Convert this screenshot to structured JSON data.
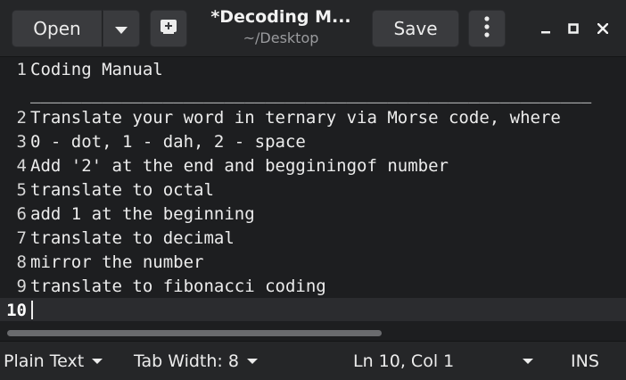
{
  "header": {
    "open_label": "Open",
    "save_label": "Save",
    "title": "*Decoding M...",
    "subtitle": "~/Desktop",
    "icons": {
      "open_menu": "chevron-down-icon",
      "new_tab": "new-tab-icon",
      "more": "more-vertical-icon",
      "minimize": "minimize-icon",
      "maximize": "maximize-icon",
      "close": "close-icon"
    }
  },
  "editor": {
    "lines": [
      {
        "num": "1",
        "text": "Coding Manual"
      },
      {
        "num": "",
        "text": "_______________________________________________________"
      },
      {
        "num": "2",
        "text": "Translate your word in ternary via Morse code, where"
      },
      {
        "num": "3",
        "text": "0 - dot, 1 - dah, 2 - space"
      },
      {
        "num": "4",
        "text": "Add '2' at the end and begginingof number"
      },
      {
        "num": "5",
        "text": "translate to octal"
      },
      {
        "num": "6",
        "text": "add 1 at the beginning"
      },
      {
        "num": "7",
        "text": "translate to decimal"
      },
      {
        "num": "8",
        "text": "mirror the number"
      },
      {
        "num": "9",
        "text": "translate to fibonacci coding"
      },
      {
        "num": "10",
        "text": ""
      }
    ],
    "current_line": "10"
  },
  "statusbar": {
    "language": "Plain Text",
    "tab_width": "Tab Width: 8",
    "position": "Ln 10, Col 1",
    "mode": "INS"
  },
  "colors": {
    "background": "#1d1e20",
    "headerbar": "#252628",
    "button": "#3a3b3e",
    "text": "#ececec",
    "current_line": "#2b2c2f"
  }
}
